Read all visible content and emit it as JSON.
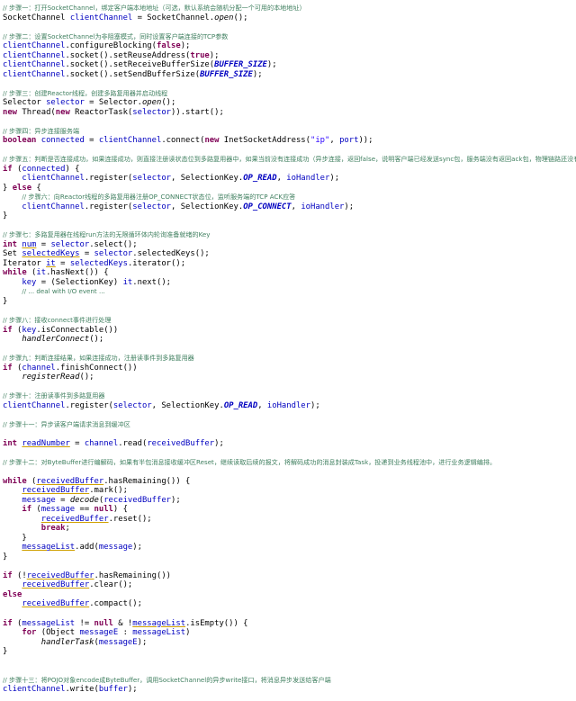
{
  "lines": [
    [
      {
        "t": "c",
        "v": "// 步骤一：打开SocketChannel，绑定客户端本地地址（可选，默认系统会随机分配一个可用的本地地址）"
      }
    ],
    [
      {
        "t": "n",
        "v": "SocketChannel "
      },
      {
        "t": "f",
        "v": "clientChannel"
      },
      {
        "t": "n",
        "v": " = SocketChannel."
      },
      {
        "t": "st",
        "v": "open"
      },
      {
        "t": "n",
        "v": "();"
      }
    ],
    [],
    [
      {
        "t": "c",
        "v": "// 步骤二：设置SocketChannel为非阻塞模式，同时设置客户端连接的TCP参数"
      }
    ],
    [
      {
        "t": "f",
        "v": "clientChannel"
      },
      {
        "t": "n",
        "v": ".configureBlocking("
      },
      {
        "t": "k",
        "v": "false"
      },
      {
        "t": "n",
        "v": ");"
      }
    ],
    [
      {
        "t": "f",
        "v": "clientChannel"
      },
      {
        "t": "n",
        "v": ".socket().setReuseAddress("
      },
      {
        "t": "k",
        "v": "true"
      },
      {
        "t": "n",
        "v": ");"
      }
    ],
    [
      {
        "t": "f",
        "v": "clientChannel"
      },
      {
        "t": "n",
        "v": ".socket().setReceiveBufferSize("
      },
      {
        "t": "cst",
        "v": "BUFFER_SIZE"
      },
      {
        "t": "n",
        "v": ");"
      }
    ],
    [
      {
        "t": "f",
        "v": "clientChannel"
      },
      {
        "t": "n",
        "v": ".socket().setSendBufferSize("
      },
      {
        "t": "cst",
        "v": "BUFFER_SIZE"
      },
      {
        "t": "n",
        "v": ");"
      }
    ],
    [],
    [
      {
        "t": "c",
        "v": "// 步骤三：创建Reactor线程，创建多路复用器并启动线程"
      }
    ],
    [
      {
        "t": "n",
        "v": "Selector "
      },
      {
        "t": "f",
        "v": "selector"
      },
      {
        "t": "n",
        "v": " = Selector."
      },
      {
        "t": "st",
        "v": "open"
      },
      {
        "t": "n",
        "v": "();"
      }
    ],
    [
      {
        "t": "k",
        "v": "new"
      },
      {
        "t": "n",
        "v": " Thread("
      },
      {
        "t": "k",
        "v": "new"
      },
      {
        "t": "n",
        "v": " ReactorTask("
      },
      {
        "t": "f",
        "v": "selector"
      },
      {
        "t": "n",
        "v": ")).start();"
      }
    ],
    [],
    [
      {
        "t": "c",
        "v": "// 步骤四：异步连接服务端"
      }
    ],
    [
      {
        "t": "k",
        "v": "boolean"
      },
      {
        "t": "n",
        "v": " "
      },
      {
        "t": "f",
        "v": "connected"
      },
      {
        "t": "n",
        "v": " = "
      },
      {
        "t": "f",
        "v": "clientChannel"
      },
      {
        "t": "n",
        "v": ".connect("
      },
      {
        "t": "k",
        "v": "new"
      },
      {
        "t": "n",
        "v": " InetSocketAddress("
      },
      {
        "t": "s",
        "v": "\"ip\""
      },
      {
        "t": "n",
        "v": ", "
      },
      {
        "t": "f",
        "v": "port"
      },
      {
        "t": "n",
        "v": "));"
      }
    ],
    [],
    [
      {
        "t": "c",
        "v": "// 步骤五：判断是否连接成功，如果连接成功，则直接注册读状态位到多路复用器中，如果当前没有连接成功（异步连接，返回false，说明客户端已经发送sync包，服务端没有返回ack包，物理链路还没有建立）"
      }
    ],
    [
      {
        "t": "k",
        "v": "if"
      },
      {
        "t": "n",
        "v": " ("
      },
      {
        "t": "f",
        "v": "connected"
      },
      {
        "t": "n",
        "v": ") {"
      }
    ],
    [
      {
        "t": "n",
        "v": "    "
      },
      {
        "t": "f",
        "v": "clientChannel"
      },
      {
        "t": "n",
        "v": ".register("
      },
      {
        "t": "f",
        "v": "selector"
      },
      {
        "t": "n",
        "v": ", SelectionKey."
      },
      {
        "t": "cst",
        "v": "OP_READ"
      },
      {
        "t": "n",
        "v": ", "
      },
      {
        "t": "f",
        "v": "ioHandler"
      },
      {
        "t": "n",
        "v": ");"
      }
    ],
    [
      {
        "t": "n",
        "v": "} "
      },
      {
        "t": "k",
        "v": "else"
      },
      {
        "t": "n",
        "v": " {"
      }
    ],
    [
      {
        "t": "n",
        "v": "    "
      },
      {
        "t": "c",
        "v": "// 步骤六：向Reactor线程的多路复用器注册OP_CONNECT状态位，监听服务端的TCP ACK应答"
      }
    ],
    [
      {
        "t": "n",
        "v": "    "
      },
      {
        "t": "f",
        "v": "clientChannel"
      },
      {
        "t": "n",
        "v": ".register("
      },
      {
        "t": "f",
        "v": "selector"
      },
      {
        "t": "n",
        "v": ", SelectionKey."
      },
      {
        "t": "cst",
        "v": "OP_CONNECT"
      },
      {
        "t": "n",
        "v": ", "
      },
      {
        "t": "f",
        "v": "ioHandler"
      },
      {
        "t": "n",
        "v": ");"
      }
    ],
    [
      {
        "t": "n",
        "v": "}"
      }
    ],
    [],
    [
      {
        "t": "c",
        "v": "// 步骤七：多路复用器在线程run方法的无限循环体内轮询准备就绪的Key"
      }
    ],
    [
      {
        "t": "k",
        "v": "int"
      },
      {
        "t": "n",
        "v": " "
      },
      {
        "t": "u",
        "v": "num"
      },
      {
        "t": "n",
        "v": " = "
      },
      {
        "t": "f",
        "v": "selector"
      },
      {
        "t": "n",
        "v": ".select();"
      }
    ],
    [
      {
        "t": "n",
        "v": "Set "
      },
      {
        "t": "u",
        "v": "selectedKeys"
      },
      {
        "t": "n",
        "v": " = "
      },
      {
        "t": "f",
        "v": "selector"
      },
      {
        "t": "n",
        "v": ".selectedKeys();"
      }
    ],
    [
      {
        "t": "n",
        "v": "Iterator "
      },
      {
        "t": "u",
        "v": "it"
      },
      {
        "t": "n",
        "v": " = "
      },
      {
        "t": "f",
        "v": "selectedKeys"
      },
      {
        "t": "n",
        "v": ".iterator();"
      }
    ],
    [
      {
        "t": "k",
        "v": "while"
      },
      {
        "t": "n",
        "v": " ("
      },
      {
        "t": "f",
        "v": "it"
      },
      {
        "t": "n",
        "v": ".hasNext()) {"
      }
    ],
    [
      {
        "t": "n",
        "v": "    "
      },
      {
        "t": "f",
        "v": "key"
      },
      {
        "t": "n",
        "v": " = (SelectionKey) "
      },
      {
        "t": "f",
        "v": "it"
      },
      {
        "t": "n",
        "v": ".next();"
      }
    ],
    [
      {
        "t": "n",
        "v": "    "
      },
      {
        "t": "c",
        "v": "// ... deal with I/O event ..."
      }
    ],
    [
      {
        "t": "n",
        "v": "}"
      }
    ],
    [],
    [
      {
        "t": "c",
        "v": "// 步骤八：接收connect事件进行处理"
      }
    ],
    [
      {
        "t": "k",
        "v": "if"
      },
      {
        "t": "n",
        "v": " ("
      },
      {
        "t": "f",
        "v": "key"
      },
      {
        "t": "n",
        "v": ".isConnectable())"
      }
    ],
    [
      {
        "t": "n",
        "v": "    "
      },
      {
        "t": "st",
        "v": "handlerConnect"
      },
      {
        "t": "n",
        "v": "();"
      }
    ],
    [],
    [
      {
        "t": "c",
        "v": "// 步骤九：判断连接结果，如果连接成功，注册读事件到多路复用器"
      }
    ],
    [
      {
        "t": "k",
        "v": "if"
      },
      {
        "t": "n",
        "v": " ("
      },
      {
        "t": "f",
        "v": "channel"
      },
      {
        "t": "n",
        "v": ".finishConnect())"
      }
    ],
    [
      {
        "t": "n",
        "v": "    "
      },
      {
        "t": "st",
        "v": "registerRead"
      },
      {
        "t": "n",
        "v": "();"
      }
    ],
    [],
    [
      {
        "t": "c",
        "v": "// 步骤十：注册读事件到多路复用器"
      }
    ],
    [
      {
        "t": "f",
        "v": "clientChannel"
      },
      {
        "t": "n",
        "v": ".register("
      },
      {
        "t": "f",
        "v": "selector"
      },
      {
        "t": "n",
        "v": ", SelectionKey."
      },
      {
        "t": "cst",
        "v": "OP_READ"
      },
      {
        "t": "n",
        "v": ", "
      },
      {
        "t": "f",
        "v": "ioHandler"
      },
      {
        "t": "n",
        "v": ");"
      }
    ],
    [],
    [
      {
        "t": "c",
        "v": "// 步骤十一：异步读客户端请求消息到缓冲区"
      }
    ],
    [],
    [
      {
        "t": "k",
        "v": "int"
      },
      {
        "t": "n",
        "v": " "
      },
      {
        "t": "u",
        "v": "readNumber"
      },
      {
        "t": "n",
        "v": " = "
      },
      {
        "t": "f",
        "v": "channel"
      },
      {
        "t": "n",
        "v": ".read("
      },
      {
        "t": "f",
        "v": "receivedBuffer"
      },
      {
        "t": "n",
        "v": ");"
      }
    ],
    [],
    [
      {
        "t": "c",
        "v": "// 步骤十二：对ByteBuffer进行编解码，如果有半包消息接收缓冲区Reset，继续读取后续的报文，将解码成功的消息封装成Task，投递到业务线程池中，进行业务逻辑编排。"
      }
    ],
    [],
    [
      {
        "t": "k",
        "v": "while"
      },
      {
        "t": "n",
        "v": " ("
      },
      {
        "t": "u",
        "v": "receivedBuffer"
      },
      {
        "t": "n",
        "v": ".hasRemaining()) {"
      }
    ],
    [
      {
        "t": "n",
        "v": "    "
      },
      {
        "t": "u",
        "v": "receivedBuffer"
      },
      {
        "t": "n",
        "v": ".mark();"
      }
    ],
    [
      {
        "t": "n",
        "v": "    "
      },
      {
        "t": "f",
        "v": "message"
      },
      {
        "t": "n",
        "v": " = "
      },
      {
        "t": "st",
        "v": "decode"
      },
      {
        "t": "n",
        "v": "("
      },
      {
        "t": "f",
        "v": "receivedBuffer"
      },
      {
        "t": "n",
        "v": ");"
      }
    ],
    [
      {
        "t": "n",
        "v": "    "
      },
      {
        "t": "k",
        "v": "if"
      },
      {
        "t": "n",
        "v": " ("
      },
      {
        "t": "f",
        "v": "message"
      },
      {
        "t": "n",
        "v": " == "
      },
      {
        "t": "k",
        "v": "null"
      },
      {
        "t": "n",
        "v": ") {"
      }
    ],
    [
      {
        "t": "n",
        "v": "        "
      },
      {
        "t": "u",
        "v": "receivedBuffer"
      },
      {
        "t": "n",
        "v": ".reset();"
      }
    ],
    [
      {
        "t": "n",
        "v": "        "
      },
      {
        "t": "k",
        "v": "break"
      },
      {
        "t": "n",
        "v": ";"
      }
    ],
    [
      {
        "t": "n",
        "v": "    }"
      }
    ],
    [
      {
        "t": "n",
        "v": "    "
      },
      {
        "t": "u",
        "v": "messageList"
      },
      {
        "t": "n",
        "v": ".add("
      },
      {
        "t": "f",
        "v": "message"
      },
      {
        "t": "n",
        "v": ");"
      }
    ],
    [
      {
        "t": "n",
        "v": "}"
      }
    ],
    [],
    [
      {
        "t": "k",
        "v": "if"
      },
      {
        "t": "n",
        "v": " (!"
      },
      {
        "t": "u",
        "v": "receivedBuffer"
      },
      {
        "t": "n",
        "v": ".hasRemaining())"
      }
    ],
    [
      {
        "t": "n",
        "v": "    "
      },
      {
        "t": "u",
        "v": "receivedBuffer"
      },
      {
        "t": "n",
        "v": ".clear();"
      }
    ],
    [
      {
        "t": "k",
        "v": "else"
      }
    ],
    [
      {
        "t": "n",
        "v": "    "
      },
      {
        "t": "u",
        "v": "receivedBuffer"
      },
      {
        "t": "n",
        "v": ".compact();"
      }
    ],
    [],
    [
      {
        "t": "k",
        "v": "if"
      },
      {
        "t": "n",
        "v": " ("
      },
      {
        "t": "f",
        "v": "messageList"
      },
      {
        "t": "n",
        "v": " != "
      },
      {
        "t": "k",
        "v": "null"
      },
      {
        "t": "n",
        "v": " & !"
      },
      {
        "t": "u",
        "v": "messageList"
      },
      {
        "t": "n",
        "v": ".isEmpty()) {"
      }
    ],
    [
      {
        "t": "n",
        "v": "    "
      },
      {
        "t": "k",
        "v": "for"
      },
      {
        "t": "n",
        "v": " (Object "
      },
      {
        "t": "f",
        "v": "messageE"
      },
      {
        "t": "n",
        "v": " : "
      },
      {
        "t": "f",
        "v": "messageList"
      },
      {
        "t": "n",
        "v": ")"
      }
    ],
    [
      {
        "t": "n",
        "v": "        "
      },
      {
        "t": "st",
        "v": "handlerTask"
      },
      {
        "t": "n",
        "v": "("
      },
      {
        "t": "f",
        "v": "messageE"
      },
      {
        "t": "n",
        "v": ");"
      }
    ],
    [
      {
        "t": "n",
        "v": "}"
      }
    ],
    [],
    [],
    [
      {
        "t": "c",
        "v": "// 步骤十三：将POJO对象encode成ByteBuffer，调用SocketChannel的异步write接口，将消息异步发送给客户端"
      }
    ],
    [
      {
        "t": "f",
        "v": "clientChannel"
      },
      {
        "t": "n",
        "v": ".write("
      },
      {
        "t": "f",
        "v": "buffer"
      },
      {
        "t": "n",
        "v": ");"
      }
    ]
  ]
}
